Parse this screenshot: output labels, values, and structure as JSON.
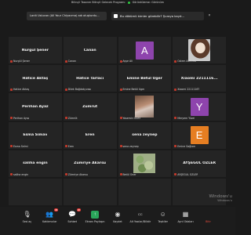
{
  "top_banner": {
    "left": "Bilinçli Tasarım Bilinçli Gelecek Programı",
    "right": "Görüntüleme: Görünüm"
  },
  "chat_popup": "Lanit Uslucan (All Your Chiyacma) adı oluşturdu...",
  "notification": {
    "text": "Bu dökümü kimler görebilir? Şuraya kayıt...",
    "close": "×"
  },
  "tiles": [
    {
      "name": "Nurgül Şener",
      "label": "Nurgül Şener",
      "kind": "name"
    },
    {
      "name": "Canan",
      "label": "Canan",
      "kind": "name"
    },
    {
      "letter": "A",
      "color": "#8e44ad",
      "label": "Ayşe Ali",
      "kind": "avatar"
    },
    {
      "label": "Özlem AKTÜRK",
      "kind": "photo-user"
    },
    {
      "name": "Hatice Aktaş",
      "label": "Hatice Aktaş",
      "kind": "name"
    },
    {
      "name": "Hatice Tarlacı",
      "label": "Dilek Bağdatçıvası",
      "kind": "name"
    },
    {
      "name": "Emine Betül Üger",
      "label": "Emine Betül Üger",
      "kind": "name"
    },
    {
      "name": "Xiaomi 2211116...",
      "label": "Xiaomi 2211116T",
      "kind": "name"
    },
    {
      "name": "Perihan Ayaz",
      "label": "Perihan Ayaz",
      "kind": "name"
    },
    {
      "name": "Zümrüt",
      "label": "Zümrüt",
      "kind": "name"
    },
    {
      "label": "Yasemin ÖZAY",
      "kind": "photo-face"
    },
    {
      "letter": "Y",
      "color": "#8e44ad",
      "label": "Meryem Yüzel",
      "kind": "avatar"
    },
    {
      "name": "Esma Simav",
      "label": "Esma Selmi",
      "kind": "name"
    },
    {
      "name": "Eren",
      "label": "Eren",
      "kind": "name"
    },
    {
      "name": "sena zeynep",
      "label": "sena zeynep",
      "kind": "name"
    },
    {
      "letter": "E",
      "color": "#e67e22",
      "label": "Emine Sağlam",
      "kind": "avatar"
    },
    {
      "name": "saliha engin",
      "label": "saliha engin",
      "kind": "name"
    },
    {
      "name": "Zümriye Akarsu",
      "label": "Zümriye Akarsu",
      "kind": "name"
    },
    {
      "label": "Betül Öner",
      "kind": "photo-nature"
    },
    {
      "name": "AYŞEGÜL ÖZLER",
      "label": "AYŞEGÜL ÖZLER",
      "kind": "name"
    },
    {
      "name": "",
      "label": "",
      "kind": "name"
    },
    {
      "name": "",
      "label": "",
      "kind": "name"
    },
    {
      "name": "",
      "label": "",
      "kind": "name"
    },
    {
      "name": "",
      "label": "",
      "kind": "name"
    }
  ],
  "watermark": {
    "line1": "Windows'u",
    "line2": "Windows'u"
  },
  "toolbar": {
    "items": [
      {
        "label": "Sesi aç",
        "icon": "microphone-icon"
      },
      {
        "label": "Katılımcılar",
        "icon": "participants-icon",
        "badge": "36"
      },
      {
        "label": "Sohbet",
        "icon": "chat-icon",
        "badge": "20"
      },
      {
        "label": "Ekranı Paylaşın",
        "icon": "share-screen-icon"
      },
      {
        "label": "Kaydet",
        "icon": "record-icon"
      },
      {
        "label": "Alt Yazılar/Bilidir",
        "icon": "captions-icon"
      },
      {
        "label": "Tepkiler",
        "icon": "reactions-icon"
      },
      {
        "label": "Ayrıl Odaları",
        "icon": "breakout-icon"
      },
      {
        "label": "Bitir",
        "icon": "leave-icon"
      }
    ]
  },
  "colors": {
    "background": "#1a1a1a",
    "tile": "#242424",
    "share_green": "#2aa65a",
    "leave_red": "#e74c3c",
    "avatar_purple": "#8e44ad",
    "avatar_orange": "#e67e22"
  }
}
